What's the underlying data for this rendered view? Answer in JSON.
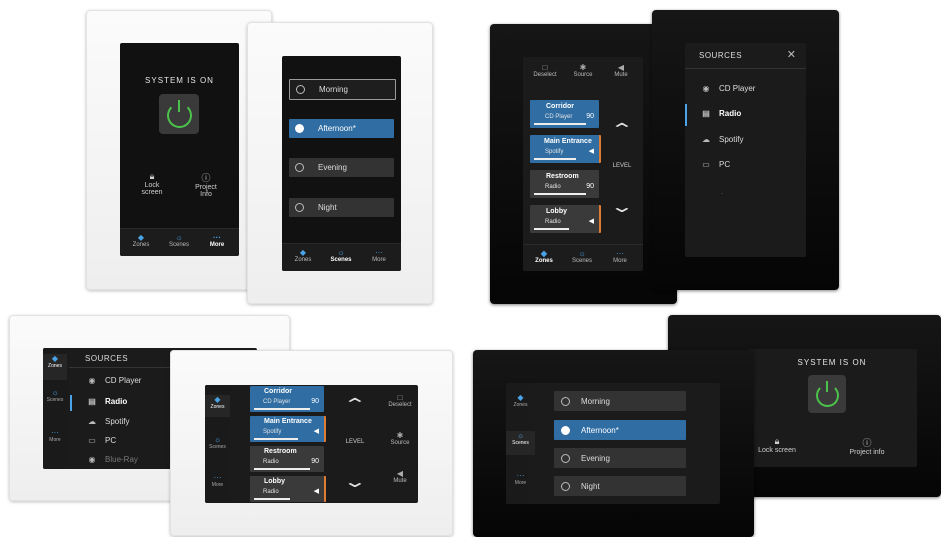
{
  "colors": {
    "accent": "#2f6da3",
    "power_green": "#4cc24c",
    "volume_orange": "#e07b32"
  },
  "system": {
    "title": "SYSTEM IS ON"
  },
  "actions": {
    "lock": "Lock screen",
    "project": "Project info",
    "lock_line1": "Lock",
    "lock_line2": "screen",
    "project_line1": "Project",
    "project_line2": "Info"
  },
  "nav": {
    "zones": "Zones",
    "scenes": "Scenes",
    "more": "More"
  },
  "scenes": [
    "Morning",
    "Afternoon*",
    "Evening",
    "Night"
  ],
  "toolbar": {
    "deselect": "Deselect",
    "source": "Source",
    "mute": "Mute"
  },
  "level": "LEVEL",
  "zones": [
    {
      "name": "Corridor",
      "source": "CD Player",
      "value": "90",
      "level": 0.75
    },
    {
      "name": "Main Entrance",
      "source": "Spotify",
      "value": "",
      "level": 0.6
    },
    {
      "name": "Restroom",
      "source": "Radio",
      "value": "90",
      "level": 0.75
    },
    {
      "name": "Lobby",
      "source": "Radio",
      "value": "",
      "level": 0.5
    }
  ],
  "sources": {
    "header": "SOURCES",
    "items": [
      "CD Player",
      "Radio",
      "Spotify",
      "PC",
      "Blue-Ray"
    ]
  },
  "icons": {
    "power": "power-icon",
    "lock": "lock-icon",
    "info": "info-icon",
    "close": "close-icon"
  }
}
